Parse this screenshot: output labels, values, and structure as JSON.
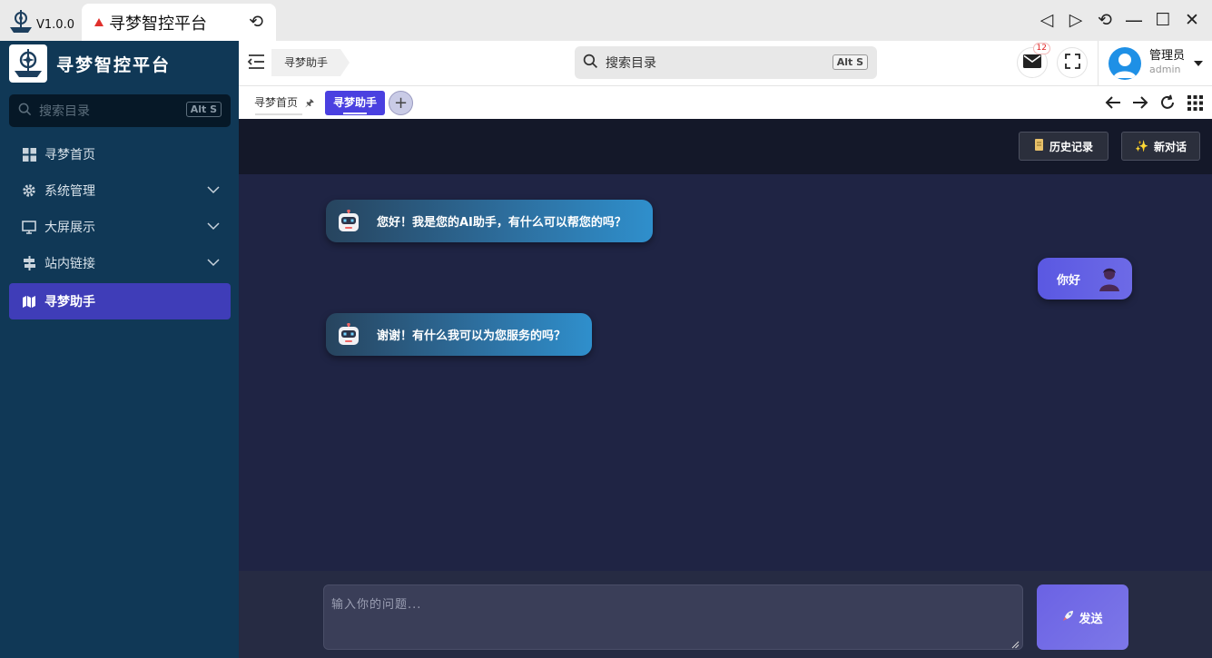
{
  "titlebar": {
    "version": "V1.0.0",
    "tab_title": "寻梦智控平台",
    "colors": {
      "tab_icon": "#e0302c"
    }
  },
  "sidebar": {
    "brand_name": "寻梦智控平台",
    "search_placeholder": "搜索目录",
    "search_shortcut": "Alt S",
    "items": [
      {
        "label": "寻梦首页",
        "icon": "grid-icon",
        "has_children": false,
        "active": false
      },
      {
        "label": "系统管理",
        "icon": "gear-icon",
        "has_children": true,
        "active": false
      },
      {
        "label": "大屏展示",
        "icon": "monitor-icon",
        "has_children": true,
        "active": false
      },
      {
        "label": "站内链接",
        "icon": "signpost-icon",
        "has_children": true,
        "active": false
      },
      {
        "label": "寻梦助手",
        "icon": "map-icon",
        "has_children": false,
        "active": true
      }
    ],
    "colors": {
      "background": "#103856",
      "active": "#3f3db8"
    }
  },
  "header": {
    "breadcrumb": "寻梦助手",
    "search_placeholder": "搜索目录",
    "search_shortcut": "Alt S",
    "mail_badge": "12",
    "user_name": "管理员",
    "user_role": "admin"
  },
  "tabs": {
    "items": [
      {
        "label": "寻梦首页",
        "pinned": true,
        "active": false
      },
      {
        "label": "寻梦助手",
        "pinned": false,
        "active": true
      }
    ],
    "colors": {
      "active": "#4a40e0"
    }
  },
  "chat": {
    "history_button": "历史记录",
    "new_chat_button": "新对话",
    "messages": [
      {
        "role": "assistant",
        "text": "您好！我是您的AI助手，有什么可以帮您的吗？"
      },
      {
        "role": "user",
        "text": "你好"
      },
      {
        "role": "assistant",
        "text": "谢谢！有什么我可以为您服务的吗？"
      }
    ],
    "input_placeholder": "输入你的问题...",
    "send_button": "发送",
    "colors": {
      "background": "#1f2444",
      "user_bubble": "#5a58e2",
      "ai_bubble": "#2d6d9c"
    }
  }
}
